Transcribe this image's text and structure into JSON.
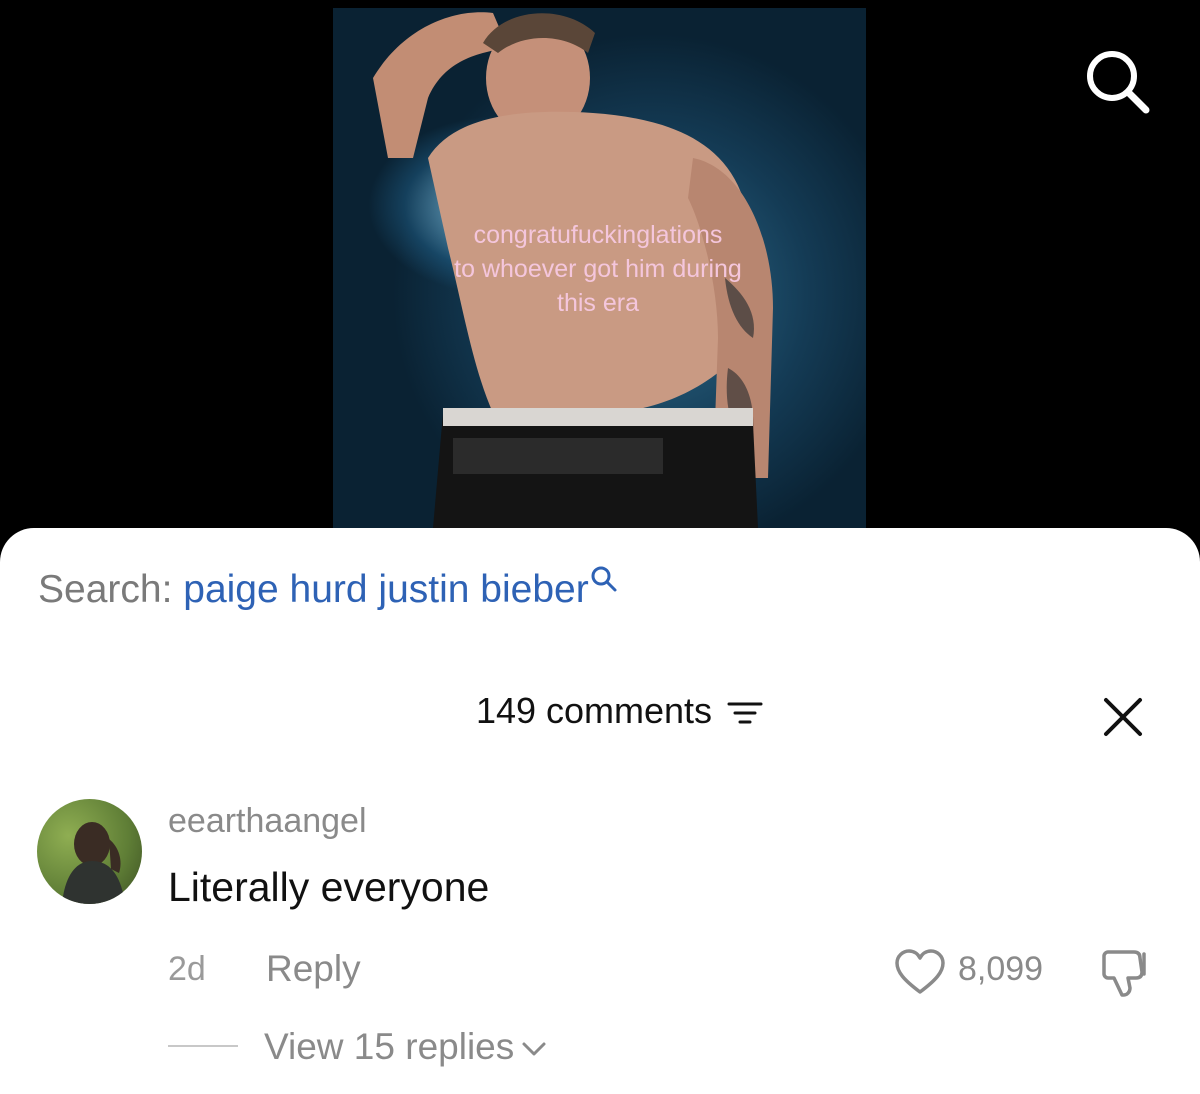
{
  "video": {
    "overlay_lines": [
      "congratufuckinglations",
      "to whoever got him during",
      "this era"
    ]
  },
  "search": {
    "prefix": "Search:",
    "query": "paige hurd justin bieber"
  },
  "comments": {
    "count_label": "149 comments"
  },
  "comment": {
    "username": "eearthaangel",
    "text": "Literally everyone",
    "age": "2d",
    "reply_label": "Reply",
    "like_count": "8,099",
    "view_replies_label": "View 15 replies"
  },
  "icons": {
    "top_right": "search-icon",
    "search_suffix": "search-icon",
    "sort": "sort-icon",
    "close": "close-icon",
    "like": "heart-icon",
    "dislike": "thumbs-down-icon",
    "expand": "chevron-down-icon"
  },
  "colors": {
    "search_query": "#2e62b5",
    "overlay_text": "#f4c6dc"
  }
}
